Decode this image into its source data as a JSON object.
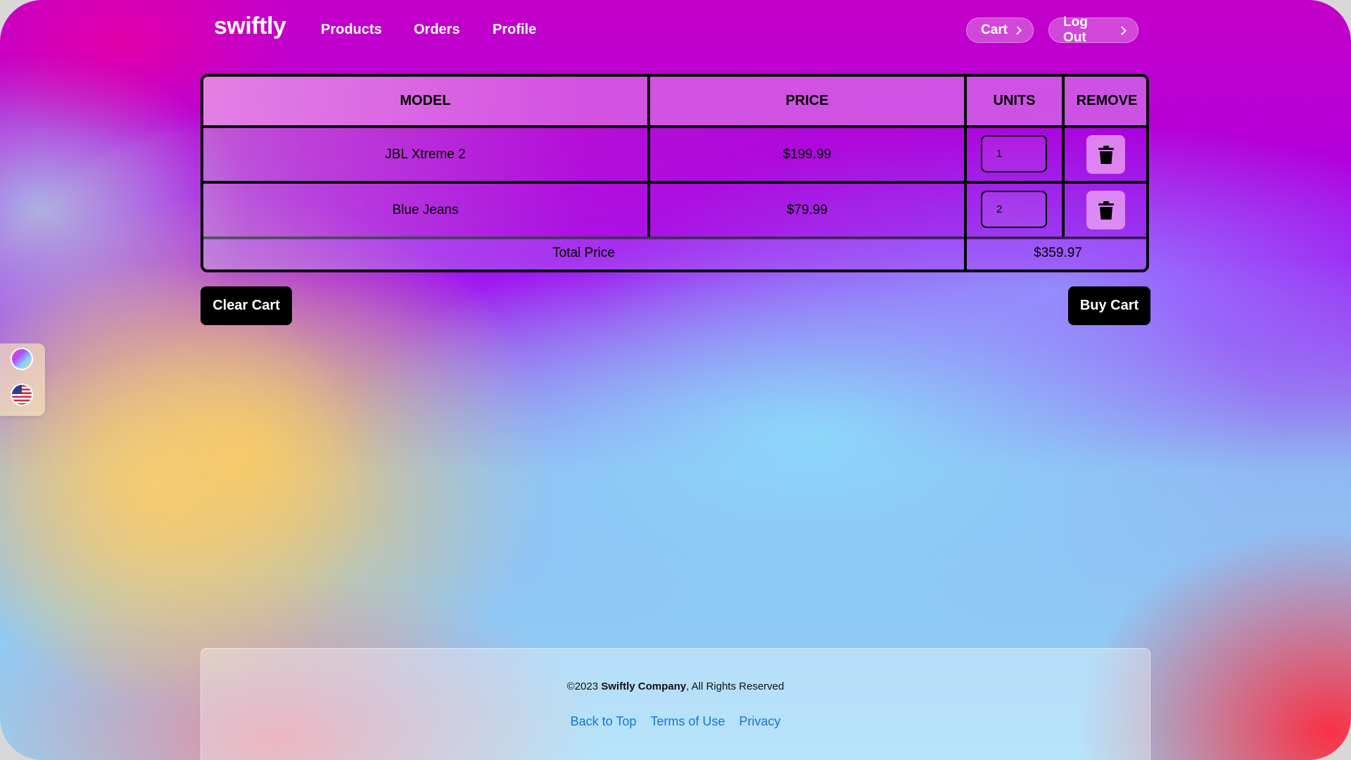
{
  "brand": "swiftly",
  "nav": {
    "links": [
      "Products",
      "Orders",
      "Profile"
    ],
    "cart_label": "Cart",
    "logout_label": "Log Out"
  },
  "table": {
    "headers": [
      "MODEL",
      "PRICE",
      "UNITS",
      "REMOVE"
    ],
    "rows": [
      {
        "model": "JBL Xtreme 2",
        "price": "$199.99",
        "units": "1"
      },
      {
        "model": "Blue Jeans",
        "price": "$79.99",
        "units": "2"
      }
    ],
    "total_label": "Total Price",
    "total_value": "$359.97"
  },
  "actions": {
    "clear_label": "Clear Cart",
    "buy_label": "Buy Cart"
  },
  "side_panel": {
    "icons": [
      "color-theme-icon",
      "us-flag-icon"
    ]
  },
  "footer": {
    "copyright_prefix": "©2023 ",
    "company": "Swiftly Company",
    "copyright_suffix": ", All Rights Reserved",
    "links": [
      "Back to Top",
      "Terms of Use",
      "Privacy"
    ]
  },
  "colors": {
    "footer_link": "#1673d8",
    "button_dark": "#000000"
  }
}
